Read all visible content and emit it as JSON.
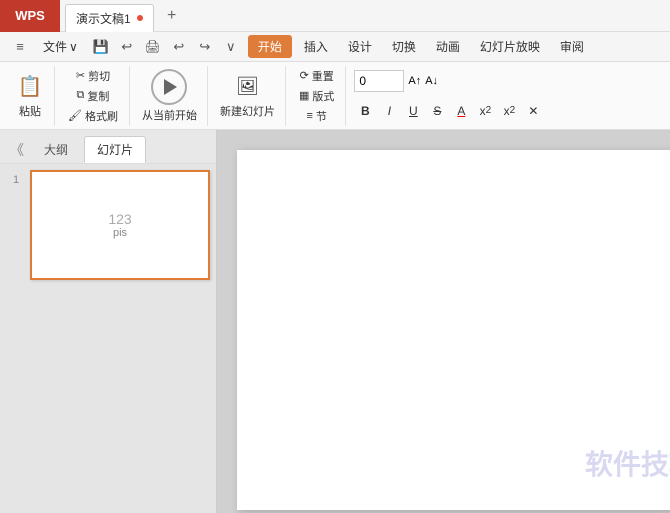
{
  "titlebar": {
    "logo": "WPS",
    "doc_tab_label": "演示文稿1",
    "new_tab_icon": "+"
  },
  "menubar": {
    "items": [
      {
        "label": "≡ 文件",
        "key": "file"
      },
      {
        "label": "↩",
        "key": "undo1"
      },
      {
        "label": "🖨",
        "key": "print"
      },
      {
        "label": "↩",
        "key": "undo2"
      },
      {
        "label": "↪",
        "key": "redo"
      },
      {
        "label": "∨",
        "key": "more"
      }
    ],
    "active_tab": "开始",
    "tabs": [
      "开始",
      "插入",
      "设计",
      "切换",
      "动画",
      "幻灯片放映",
      "审阅"
    ]
  },
  "ribbon": {
    "paste_label": "粘贴",
    "cut_label": "剪切",
    "copy_label": "复制",
    "format_painter_label": "格式刷",
    "play_label": "从当前开始",
    "new_slide_label": "新建幻灯片",
    "layout_label": "版式",
    "reset_label": "重置",
    "section_label": "节",
    "font_size_value": "0",
    "font_size_increase": "A↑",
    "font_size_decrease": "A↓",
    "bold": "B",
    "italic": "I",
    "underline": "U",
    "strikethrough": "S",
    "font_color": "A",
    "superscript": "x²",
    "subscript": "x₂",
    "clear_format": "✕"
  },
  "sidebar": {
    "collapse_icon": "《",
    "tabs": [
      {
        "label": "大纲",
        "key": "outline"
      },
      {
        "label": "幻灯片",
        "key": "slide",
        "active": true
      }
    ],
    "slide_number": "1",
    "slide_preview": {
      "number": "123",
      "sub": "pis"
    }
  },
  "watermark": "软件技巧"
}
